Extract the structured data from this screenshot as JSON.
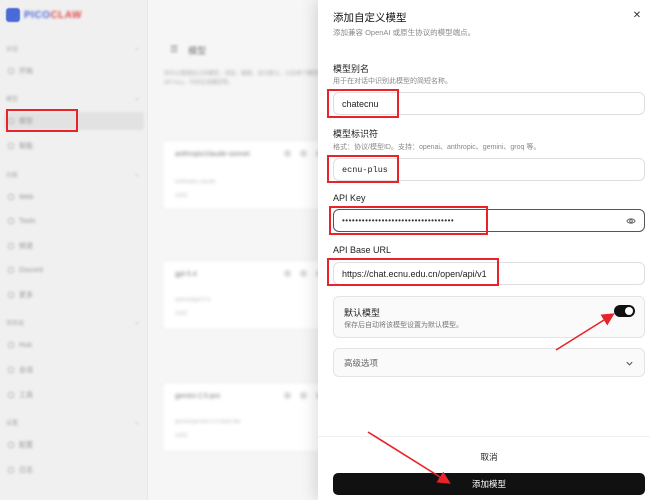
{
  "app": {
    "logo_prefix": "PICO",
    "logo_suffix": "CLAW"
  },
  "background": {
    "sidebar": {
      "groups": [
        "对话",
        "模型",
        "功能",
        "项目组",
        "设置"
      ],
      "items": [
        "开始",
        "模型",
        "智能",
        "Web",
        "Tools",
        "频道",
        "Discord",
        "更多",
        "Hub",
        "会话",
        "工具",
        "配置",
        "日志"
      ]
    },
    "page_title": "模型",
    "description": "你可以管理自己的模型，添加、编辑、设为默认，以及单个模型的 API Key、代码生成模型等。",
    "cards": [
      {
        "name": "anthropic/claude-sonnet",
        "subtitle": "anthropic-claude",
        "tag": "1920"
      },
      {
        "name": "gpt-5.4",
        "subtitle": "openai/gpt-5.4",
        "tag": "1920"
      },
      {
        "name": "gemini-2.5-pro",
        "subtitle": "gemini/gemini-2.5-flash-lite",
        "tag": "1920"
      }
    ]
  },
  "drawer": {
    "title": "添加自定义模型",
    "subtitle": "添加兼容 OpenAI 或原生协议的模型端点。",
    "alias": {
      "label": "模型别名",
      "hint": "用于在对话中识别此模型的简短名称。",
      "value": "chatecnu"
    },
    "identifier": {
      "label": "模型标识符",
      "hint": "格式：协议/模型ID。支持：openai、anthropic、gemini、groq 等。",
      "value": "ecnu-plus"
    },
    "api_key": {
      "label": "API Key",
      "masked_value": "••••••••••••••••••••••••••••••••••"
    },
    "api_base_url": {
      "label": "API Base URL",
      "value": "https://chat.ecnu.edu.cn/open/api/v1"
    },
    "default_model": {
      "title": "默认模型",
      "description": "保存后自动将该模型设置为默认模型。",
      "enabled": true
    },
    "advanced_label": "高级选项",
    "cancel_label": "取消",
    "submit_label": "添加模型"
  },
  "colors": {
    "highlight": "#e8232a",
    "primary": "#111111",
    "accent": "#4a6ad8"
  }
}
